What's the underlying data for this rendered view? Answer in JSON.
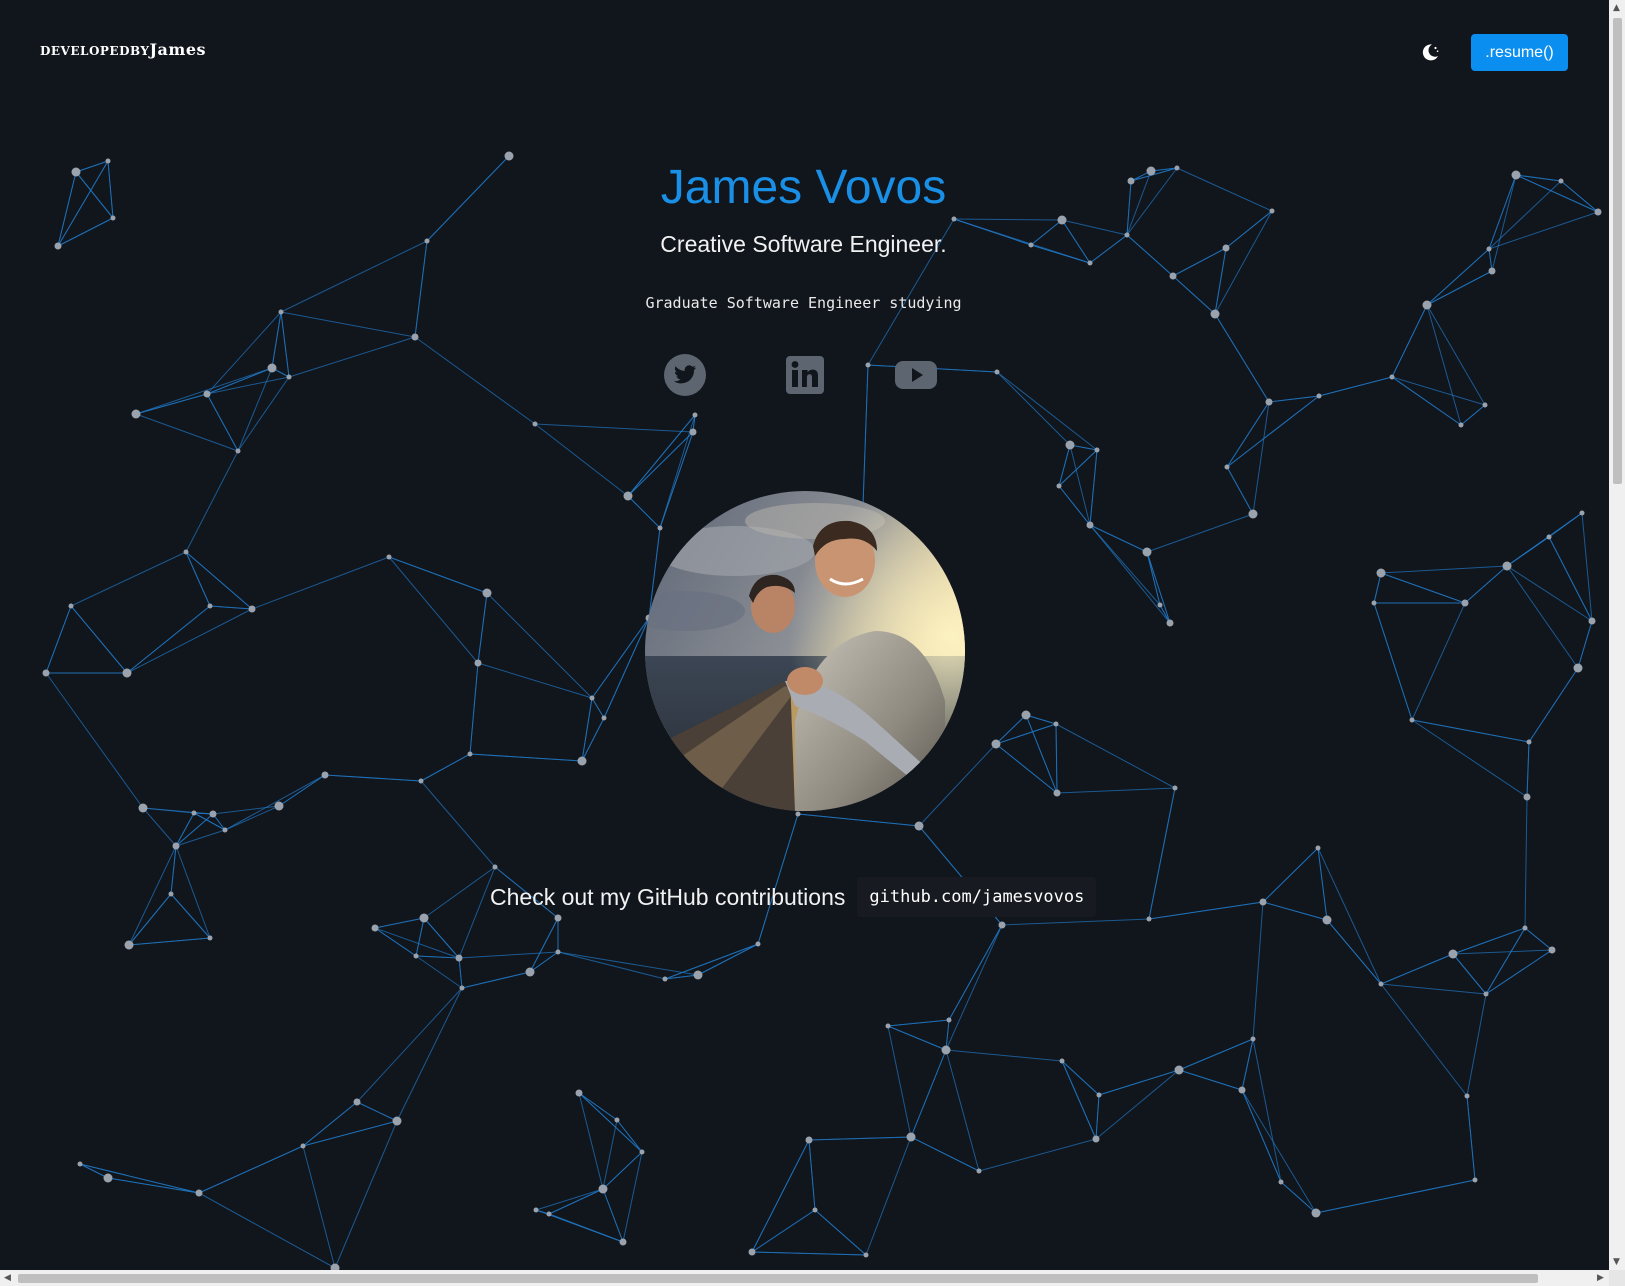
{
  "brand": {
    "part1": "developedby",
    "part2": "James"
  },
  "header": {
    "resume_label": ".resume()",
    "theme_icon": "moon-icon"
  },
  "hero": {
    "name": "James Vovos",
    "title": "Creative Software Engineer.",
    "typed_text": "Graduate Software Engineer studying"
  },
  "social": [
    {
      "name": "twitter",
      "icon": "twitter-icon"
    },
    {
      "name": "linkedin",
      "icon": "linkedin-icon"
    },
    {
      "name": "youtube",
      "icon": "youtube-icon"
    }
  ],
  "github": {
    "text": "Check out my GitHub contributions",
    "link": "github.com/jamesvovos"
  },
  "colors": {
    "background": "#11151c",
    "accent": "#1a8fe6",
    "button": "#0a8ff0",
    "node": "#9aa3ad",
    "edge": "#1f78c4",
    "icon": "#5c6570"
  }
}
